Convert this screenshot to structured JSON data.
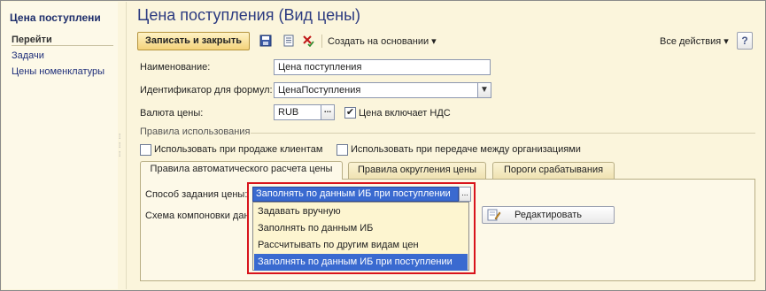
{
  "sidebar": {
    "title": "Цена поступлени",
    "heading": "Перейти",
    "links": [
      "Задачи",
      "Цены номенклатуры"
    ]
  },
  "header": {
    "title": "Цена поступления (Вид цены)"
  },
  "toolbar": {
    "save_close": "Записать и закрыть",
    "create_based": "Создать на основании ▾",
    "all_actions": "Все действия ▾",
    "help": "?"
  },
  "form": {
    "name_label": "Наименование:",
    "name_value": "Цена поступления",
    "formula_id_label": "Идентификатор для формул:",
    "formula_id_value": "ЦенаПоступления",
    "currency_label": "Валюта цены:",
    "currency_value": "RUB",
    "currency_btn": "...",
    "vat_included_label": "Цена включает НДС",
    "vat_included_checked": true
  },
  "usage": {
    "group_label": "Правила использования",
    "sell_clients_label": "Использовать при продаже клиентам",
    "sell_clients_checked": false,
    "transfer_orgs_label": "Использовать при передаче между организациями",
    "transfer_orgs_checked": false
  },
  "tabs": [
    {
      "label": "Правила автоматического расчета цены",
      "active": true
    },
    {
      "label": "Правила округления цены",
      "active": false
    },
    {
      "label": "Пороги срабатывания",
      "active": false
    }
  ],
  "tab_content": {
    "method_label": "Способ задания цены:",
    "method_value": "Заполнять по данным ИБ при поступлении",
    "method_btn": "...",
    "scheme_label": "Схема компоновки дан",
    "edit_button": "Редактировать"
  },
  "dropdown": {
    "options": [
      "Задавать вручную",
      "Заполнять по данным ИБ",
      "Рассчитывать по другим видам цен",
      "Заполнять по данным ИБ при поступлении"
    ],
    "selected_index": 3
  },
  "colors": {
    "accent_selection": "#3a6ad0",
    "highlight_border": "#d8141c",
    "title_text": "#2b3a80"
  }
}
